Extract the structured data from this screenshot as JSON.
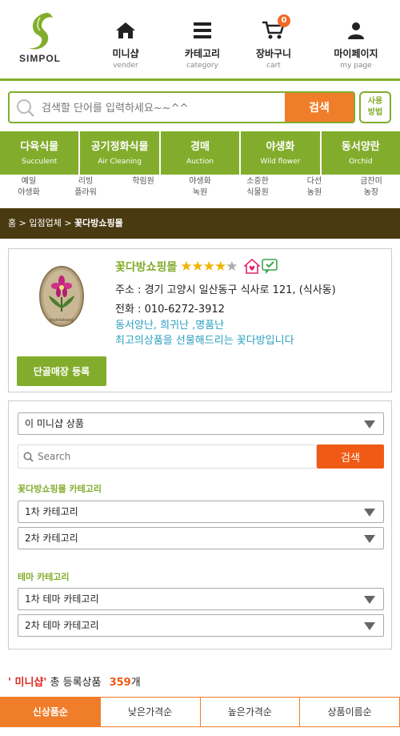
{
  "header": {
    "logo_text": "SIMPOL",
    "nav": [
      {
        "label": "미니샵",
        "sub": "vender",
        "icon": "home-icon"
      },
      {
        "label": "카테고리",
        "sub": "category",
        "icon": "menu-icon"
      },
      {
        "label": "장바구니",
        "sub": "cart",
        "icon": "cart-icon",
        "badge": "0"
      },
      {
        "label": "마이페이지",
        "sub": "my page",
        "icon": "user-icon"
      }
    ]
  },
  "search": {
    "placeholder": "검색할 단어를 입력하세요~~^^",
    "button_label": "검색",
    "howto_label_1": "사용",
    "howto_label_2": "방법"
  },
  "categories": [
    {
      "label": "다육식물",
      "sub": "Succulent"
    },
    {
      "label": "공기정화식물",
      "sub": "Air Cleaning"
    },
    {
      "label": "경매",
      "sub": "Auction"
    },
    {
      "label": "야생화",
      "sub": "Wild flower"
    },
    {
      "label": "동서양란",
      "sub": "Orchid"
    }
  ],
  "sub_links": [
    {
      "line1": "예일",
      "line2": "야생화"
    },
    {
      "line1": "리빙",
      "line2": "플라워"
    },
    {
      "line1": "학림원",
      "line2": ""
    },
    {
      "line1": "야생화",
      "line2": "녹원"
    },
    {
      "line1": "소중한",
      "line2": "식물원"
    },
    {
      "line1": "다선",
      "line2": "농원"
    },
    {
      "line1": "금잔미",
      "line2": "농장"
    }
  ],
  "breadcrumb": {
    "home": "홈",
    "sep": ">",
    "level1": "입점업체",
    "current": "꽃다방쇼핑몰"
  },
  "shop": {
    "name": "꽃다방쇼핑몰",
    "rating": 4.0,
    "rating_max": 5,
    "address": "주소 : 경기 고양시 일산동구 식사로 121, (식사동)",
    "phone": "전화 : 010-6272-3912",
    "desc1": "동서양난, 희귀난 ,명품난",
    "desc2": "최고의상품을 선물해드리는 꽃다방입니다",
    "logo_caption": "kkotdabang",
    "regular_button": "단골매장 등록"
  },
  "filter": {
    "scope_select": "이 미니샵 상품",
    "search_placeholder": "Search",
    "search_button": "검색",
    "shop_category_label": "꽃다방쇼핑몰 카테고리",
    "cat1_select": "1차 카테고리",
    "cat2_select": "2차 카테고리",
    "theme_label": "테마 카테고리",
    "theme1_select": "1차 테마 카테고리",
    "theme2_select": "2차 테마 카테고리"
  },
  "summary": {
    "tag": "' 미니샵'",
    "text": "총 등록상품",
    "count": "359",
    "unit": "개"
  },
  "sort_tabs": [
    {
      "label": "신상품순",
      "active": true
    },
    {
      "label": "낮은가격순",
      "active": false
    },
    {
      "label": "높은가격순",
      "active": false
    },
    {
      "label": "상품이름순",
      "active": false
    }
  ],
  "colors": {
    "brand_green": "#82ad2c",
    "accent_orange": "#f07d2a",
    "breadcrumb_brown": "#4a3a11",
    "desc_blue": "#2aa0c0"
  }
}
